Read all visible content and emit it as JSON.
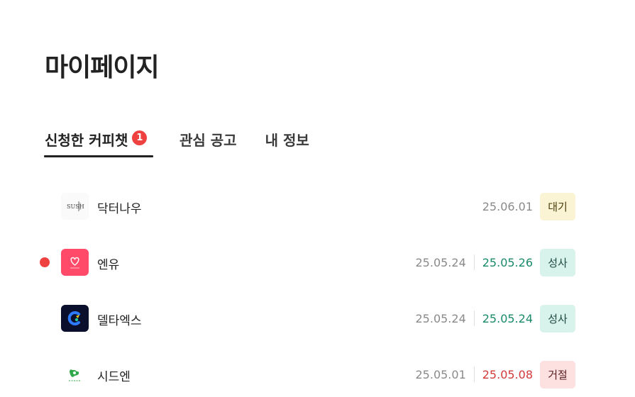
{
  "page": {
    "title": "마이페이지"
  },
  "tabs": [
    {
      "label": "신청한 커피챗",
      "badge": "1",
      "active": true
    },
    {
      "label": "관심 공고",
      "active": false
    },
    {
      "label": "내 정보",
      "active": false
    }
  ],
  "applications": [
    {
      "company": "닥터나우",
      "logo_icon": "sush-logo-icon",
      "unread": false,
      "applied_date": "25.06.01",
      "result_date": "",
      "status": "대기",
      "status_color": "#4a3b0a",
      "status_bg": "#fbf4d4"
    },
    {
      "company": "엔유",
      "logo_icon": "heart-logo-icon",
      "unread": true,
      "applied_date": "25.05.24",
      "result_date": "25.05.26",
      "result_color": "#1a8a6a",
      "status": "성사",
      "status_color": "#1f4a3f",
      "status_bg": "#d8f2ec"
    },
    {
      "company": "델타엑스",
      "logo_icon": "delta-logo-icon",
      "unread": false,
      "applied_date": "25.05.24",
      "result_date": "25.05.24",
      "result_color": "#1a8a6a",
      "status": "성사",
      "status_color": "#1f4a3f",
      "status_bg": "#d8f2ec"
    },
    {
      "company": "시드엔",
      "logo_icon": "razer-logo-icon",
      "unread": false,
      "applied_date": "25.05.01",
      "result_date": "25.05.08",
      "result_color": "#d23a3a",
      "status": "거절",
      "status_color": "#5a1f1f",
      "status_bg": "#fde0e0"
    }
  ],
  "colors": {
    "accent_red": "#f04141",
    "text": "#222222"
  }
}
